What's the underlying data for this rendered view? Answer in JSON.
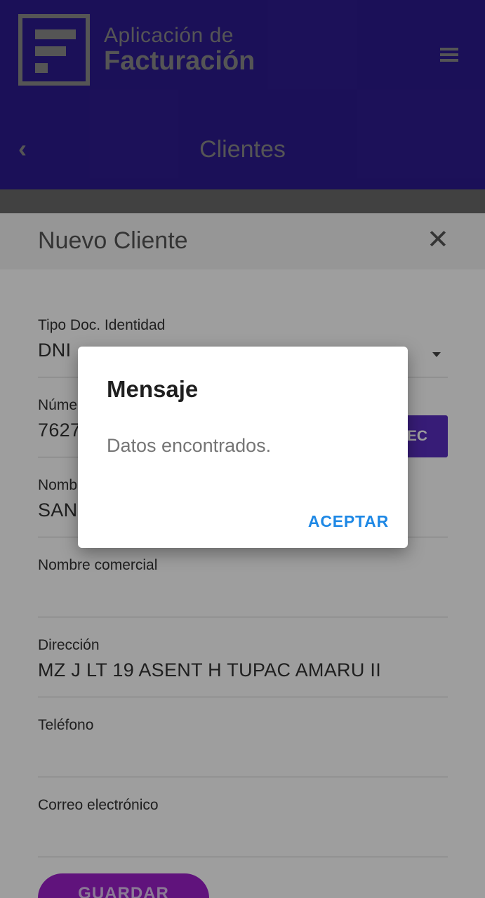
{
  "header": {
    "brand_line1": "Aplicación de",
    "brand_line2": "Facturación",
    "title": "Clientes",
    "menu_icon": "hamburger-menu-icon",
    "back_icon": "chevron-left-icon"
  },
  "sheet": {
    "title": "Nuevo Cliente",
    "close_icon": "close-icon",
    "fields": {
      "tipo_doc": {
        "label": "Tipo Doc. Identidad",
        "value": "DNI"
      },
      "numero": {
        "label": "Núme",
        "value": "7627"
      },
      "nombre": {
        "label": "Nomb",
        "value": "SAN"
      },
      "nombre_comercial": {
        "label": "Nombre comercial",
        "value": ""
      },
      "direccion": {
        "label": "Dirección",
        "value": "MZ J LT 19 ASENT H TUPAC AMARU II"
      },
      "telefono": {
        "label": "Teléfono",
        "value": ""
      },
      "correo": {
        "label": "Correo electrónico",
        "value": ""
      }
    },
    "reniec_button": "IEC",
    "save_button": "GUARDAR"
  },
  "dialog": {
    "title": "Mensaje",
    "message": "Datos encontrados.",
    "accept_button": "ACEPTAR"
  },
  "colors": {
    "header_bg": "#2d1b8f",
    "accent_purple": "#5a2ec0",
    "save_button": "#9b1fc9",
    "dialog_action": "#1e88e5"
  }
}
